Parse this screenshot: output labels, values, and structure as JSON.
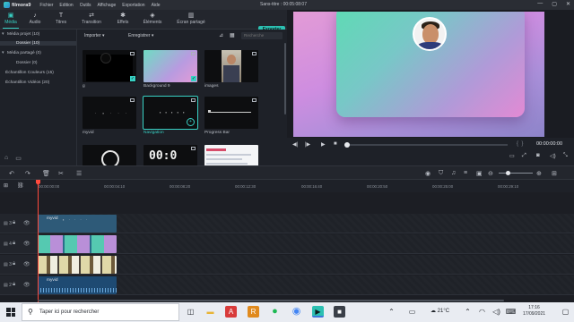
{
  "app": {
    "name": "filmora9",
    "menus": [
      "Fichier",
      "Edition",
      "Outils",
      "Affichage",
      "Exportation",
      "Aide"
    ],
    "title": "Sans-titre : 00:05:08:07",
    "window_controls": [
      "—",
      "▢",
      "✕"
    ]
  },
  "tabs": [
    {
      "label": "Média",
      "icon": "folder-icon",
      "glyph": "▣",
      "active": true
    },
    {
      "label": "Audio",
      "icon": "music-icon",
      "glyph": "♪",
      "active": false
    },
    {
      "label": "Titres",
      "icon": "text-icon",
      "glyph": "T",
      "active": false
    },
    {
      "label": "Transition",
      "icon": "transition-icon",
      "glyph": "⇄",
      "active": false
    },
    {
      "label": "Effets",
      "icon": "effects-icon",
      "glyph": "✱",
      "active": false
    },
    {
      "label": "Éléments",
      "icon": "elements-icon",
      "glyph": "◈",
      "active": false
    },
    {
      "label": "Écran partagé",
      "icon": "split-screen-icon",
      "glyph": "▥",
      "active": false
    }
  ],
  "export_label": "Exporter",
  "tree": [
    {
      "label": "Média projet (10)",
      "arrow": "▾"
    },
    {
      "label": "Dossier (10)",
      "arrow": "",
      "selected": true
    },
    {
      "label": "Média partagé (0)",
      "arrow": "▾"
    },
    {
      "label": "Dossier (0)",
      "arrow": ""
    },
    {
      "label": "Échantillon Couleurs (15)",
      "arrow": ""
    },
    {
      "label": "Échantillon Vidéos (20)",
      "arrow": ""
    }
  ],
  "media_toolbar": {
    "import_label": "Importer",
    "record_label": "Enregistrer",
    "search_placeholder": "Recherche"
  },
  "media_items": [
    {
      "label": "g",
      "kind": "dark-dot",
      "checked": true
    },
    {
      "label": "Background 9",
      "kind": "gradient",
      "checked": true
    },
    {
      "label": "images",
      "kind": "photo",
      "checked": false
    },
    {
      "label": "myvid",
      "kind": "dark-dots",
      "checked": false
    },
    {
      "label": "Navigation",
      "kind": "navigation",
      "checked": false,
      "selected": true
    },
    {
      "label": "Progress Bar",
      "kind": "progress",
      "checked": false
    },
    {
      "label": "",
      "kind": "circle",
      "checked": false
    },
    {
      "label": "",
      "kind": "counter",
      "counter_text": "00:0",
      "checked": false
    },
    {
      "label": "",
      "kind": "screenshot",
      "checked": false
    }
  ],
  "player": {
    "timecode": "00:00:00:00",
    "progress_fraction": 0.0
  },
  "ruler_ticks": [
    "00:00:00:00",
    "00:00:04:10",
    "00:00:08:20",
    "00:00:12:30",
    "00:00:16:40",
    "00:00:20:50",
    "00:00:25:00",
    "00:00:29:10"
  ],
  "tracks": [
    {
      "number": "3",
      "clip_label": "myvid",
      "clip": "myvid"
    },
    {
      "number": "4",
      "clip_label": "",
      "clip": "gradient"
    },
    {
      "number": "3",
      "clip_label": "",
      "clip": "people"
    },
    {
      "number": "2",
      "clip_label": "myvid",
      "clip": "audio"
    }
  ],
  "taskbar": {
    "search_placeholder": "Taper ici pour rechercher",
    "weather": "21°C",
    "time": "17:16",
    "date": "17/09/2021",
    "apps": [
      {
        "icon": "task-view-icon",
        "glyph": "◫",
        "color": "#1f2329"
      },
      {
        "icon": "explorer-icon",
        "glyph": "▬",
        "color": "#e8b436"
      },
      {
        "icon": "app-red-icon",
        "glyph": "A",
        "color": "#d83b3b"
      },
      {
        "icon": "app-orange-icon",
        "glyph": "R",
        "color": "#e08a1e"
      },
      {
        "icon": "spotify-icon",
        "glyph": "●",
        "color": "#1db954"
      },
      {
        "icon": "chrome-icon",
        "glyph": "◉",
        "color": "#4285f4"
      },
      {
        "icon": "filmora-icon",
        "glyph": "▶",
        "color": "#2cc0b2"
      },
      {
        "icon": "app-dark-icon",
        "glyph": "■",
        "color": "#3a3f48"
      }
    ]
  },
  "colors": {
    "accent": "#38d1c4",
    "playhead": "#ff4a3d",
    "panel": "#1e2128"
  }
}
